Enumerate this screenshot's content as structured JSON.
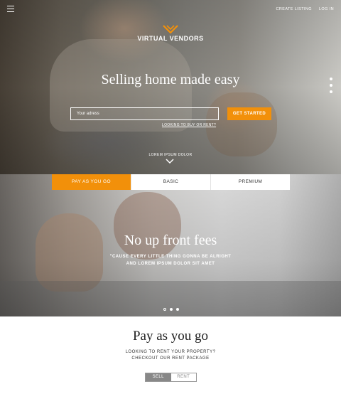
{
  "header": {
    "menu_icon": "hamburger-icon",
    "links": [
      "CREATE LISTING",
      "LOG IN"
    ]
  },
  "logo": {
    "text": "VIRTUAL VENDORS",
    "mark_color": "#f2900a"
  },
  "hero": {
    "headline": "Selling home made easy",
    "address_placeholder": "Your adress",
    "cta": "GET STARTED",
    "sub_link": "LOOKING TO BUY OR RENT?",
    "scroll_label": "LOREM IPSUM DOLOR",
    "scroll_icon": "chevron-down-icon"
  },
  "tabs": [
    {
      "label": "PAY AS YOU GO",
      "active": true
    },
    {
      "label": "BASIC",
      "active": false
    },
    {
      "label": "PREMIUM",
      "active": false
    }
  ],
  "band": {
    "title": "No up front fees",
    "quote_line1": "\"CAUSE EVERY LITTLE THING GONNA BE ALRIGHT",
    "quote_line2": "AND LOREM IPSUM DOLOR SIT AMET"
  },
  "pay": {
    "title": "Pay as you go",
    "sub_line1": "LOOKING TO RENT YOUR PROPERTY?",
    "sub_line2": "CHECKOUT OUR RENT PACKAGE",
    "toggle": {
      "sell": "SELL",
      "rent": "RENT",
      "selected": "SELL"
    }
  },
  "colors": {
    "accent": "#f2900a",
    "text_dark": "#222222"
  }
}
